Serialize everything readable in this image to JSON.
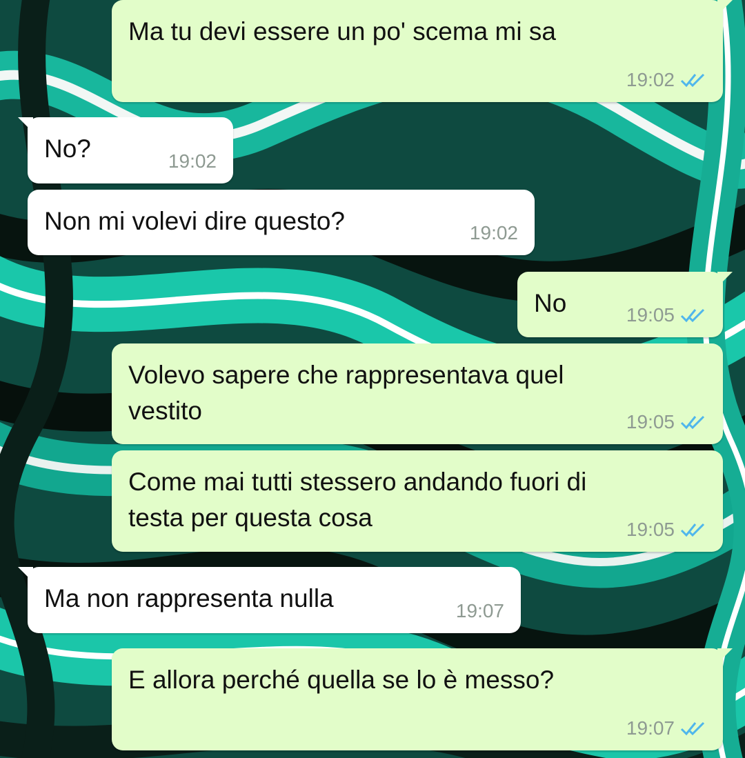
{
  "colors": {
    "outgoing_bubble": "#e2fdc9",
    "incoming_bubble": "#ffffff",
    "read_ticks": "#4fb6ec",
    "timestamp": "#8e9a92",
    "wallpaper_primary": "#17b39a",
    "wallpaper_dark": "#07140f"
  },
  "messages": [
    {
      "direction": "outgoing",
      "text": "Ma tu devi essere un po' scema mi sa",
      "time": "19:02",
      "status_icon": "double-check-read-icon"
    },
    {
      "direction": "incoming",
      "text": "No?",
      "time": "19:02"
    },
    {
      "direction": "incoming",
      "text": "Non mi volevi dire questo?",
      "time": "19:02"
    },
    {
      "direction": "outgoing",
      "text": "No",
      "time": "19:05",
      "status_icon": "double-check-read-icon"
    },
    {
      "direction": "outgoing",
      "text": "Volevo sapere che rappresentava quel\nvestito",
      "time": "19:05",
      "status_icon": "double-check-read-icon"
    },
    {
      "direction": "outgoing",
      "text": "Come mai tutti stessero andando fuori di\ntesta per questa cosa",
      "time": "19:05",
      "status_icon": "double-check-read-icon"
    },
    {
      "direction": "incoming",
      "text": "Ma non rappresenta nulla",
      "time": "19:07"
    },
    {
      "direction": "outgoing",
      "text": "E allora perché quella se lo è messo?",
      "time": "19:07",
      "status_icon": "double-check-read-icon"
    }
  ]
}
